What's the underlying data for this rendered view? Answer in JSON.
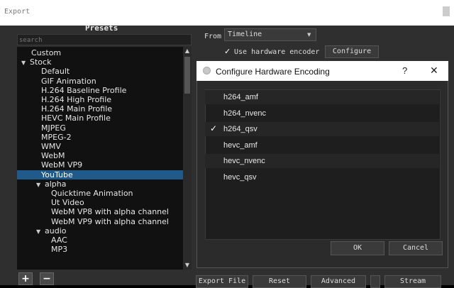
{
  "window": {
    "title": "Export"
  },
  "presets": {
    "title": "Presets",
    "search_placeholder": "search",
    "items": [
      {
        "label": "Custom",
        "indent": 1,
        "expander": ""
      },
      {
        "label": "Stock",
        "indent": 0,
        "expander": "▼"
      },
      {
        "label": "Default",
        "indent": 2,
        "expander": ""
      },
      {
        "label": "GIF Animation",
        "indent": 2,
        "expander": ""
      },
      {
        "label": "H.264 Baseline Profile",
        "indent": 2,
        "expander": ""
      },
      {
        "label": "H.264 High Profile",
        "indent": 2,
        "expander": ""
      },
      {
        "label": "H.264 Main Profile",
        "indent": 2,
        "expander": ""
      },
      {
        "label": "HEVC Main Profile",
        "indent": 2,
        "expander": ""
      },
      {
        "label": "MJPEG",
        "indent": 2,
        "expander": ""
      },
      {
        "label": "MPEG-2",
        "indent": 2,
        "expander": ""
      },
      {
        "label": "WMV",
        "indent": 2,
        "expander": ""
      },
      {
        "label": "WebM",
        "indent": 2,
        "expander": ""
      },
      {
        "label": "WebM VP9",
        "indent": 2,
        "expander": ""
      },
      {
        "label": "YouTube",
        "indent": 2,
        "expander": "",
        "selected": true
      },
      {
        "label": "alpha",
        "indent": 1.5,
        "expander": "▼"
      },
      {
        "label": "Quicktime Animation",
        "indent": 3,
        "expander": ""
      },
      {
        "label": "Ut Video",
        "indent": 3,
        "expander": ""
      },
      {
        "label": "WebM VP8 with alpha channel",
        "indent": 3,
        "expander": ""
      },
      {
        "label": "WebM VP9 with alpha channel",
        "indent": 3,
        "expander": ""
      },
      {
        "label": "audio",
        "indent": 1.5,
        "expander": "▼"
      },
      {
        "label": "AAC",
        "indent": 3,
        "expander": ""
      },
      {
        "label": "MP3",
        "indent": 3,
        "expander": ""
      }
    ],
    "add_label": "+",
    "remove_label": "−"
  },
  "from": {
    "label": "From",
    "value": "Timeline"
  },
  "hardware": {
    "checked_mark": "✓",
    "label": "Use hardware encoder",
    "configure_label": "Configure"
  },
  "dialog": {
    "title": "Configure Hardware Encoding",
    "help": "?",
    "close": "✕",
    "encoders": [
      {
        "name": "h264_amf",
        "checked": false
      },
      {
        "name": "h264_nvenc",
        "checked": false
      },
      {
        "name": "h264_qsv",
        "checked": true
      },
      {
        "name": "hevc_amf",
        "checked": false
      },
      {
        "name": "hevc_nvenc",
        "checked": false
      },
      {
        "name": "hevc_qsv",
        "checked": false
      }
    ],
    "check_glyph": "✓",
    "ok_label": "OK",
    "cancel_label": "Cancel"
  },
  "bottom": {
    "export_file": "Export File",
    "reset": "Reset",
    "advanced": "Advanced",
    "stream": "Stream"
  },
  "colors": {
    "selection": "#1f5a8a",
    "panel": "#2f2f2f"
  }
}
